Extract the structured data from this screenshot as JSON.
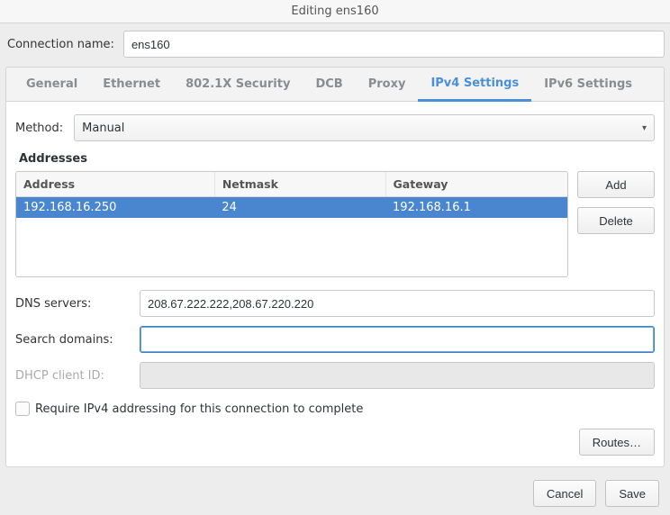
{
  "window": {
    "title": "Editing ens160"
  },
  "connection": {
    "label": "Connection name:",
    "value": "ens160"
  },
  "tabs": {
    "general": "General",
    "ethernet": "Ethernet",
    "security": "802.1X Security",
    "dcb": "DCB",
    "proxy": "Proxy",
    "ipv4": "IPv4 Settings",
    "ipv6": "IPv6 Settings"
  },
  "method": {
    "label": "Method:",
    "value": "Manual"
  },
  "addresses": {
    "title": "Addresses",
    "headers": {
      "address": "Address",
      "netmask": "Netmask",
      "gateway": "Gateway"
    },
    "rows": [
      {
        "address": "192.168.16.250",
        "netmask": "24",
        "gateway": "192.168.16.1",
        "selected": true
      }
    ],
    "add": "Add",
    "delete": "Delete"
  },
  "dns": {
    "label": "DNS servers:",
    "value": "208.67.222.222,208.67.220.220"
  },
  "search": {
    "label": "Search domains:",
    "value": ""
  },
  "dhcpid": {
    "label": "DHCP client ID:",
    "value": ""
  },
  "require": {
    "label": "Require IPv4 addressing for this connection to complete"
  },
  "routes": {
    "label": "Routes…"
  },
  "buttons": {
    "cancel": "Cancel",
    "save": "Save"
  }
}
